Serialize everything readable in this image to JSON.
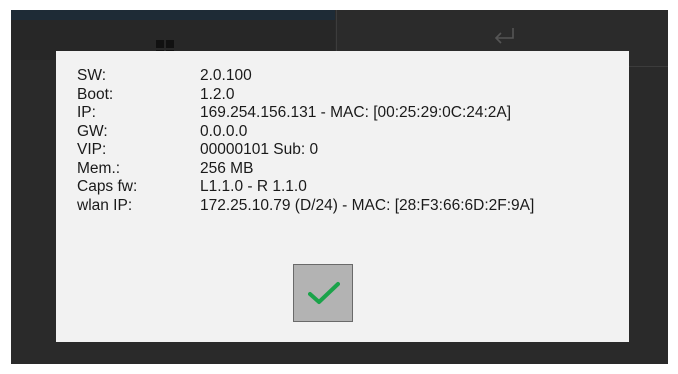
{
  "toolbar": {
    "left_icon": "grid-icon",
    "right_icon": "return-icon"
  },
  "dialog": {
    "rows": [
      {
        "label": "SW:",
        "value": "2.0.100"
      },
      {
        "label": "Boot:",
        "value": "1.2.0"
      },
      {
        "label": "IP:",
        "value": "169.254.156.131 - MAC: [00:25:29:0C:24:2A]"
      },
      {
        "label": "GW:",
        "value": "0.0.0.0"
      },
      {
        "label": "VIP:",
        "value": "00000101 Sub: 0"
      },
      {
        "label": "Mem.:",
        "value": "256 MB"
      },
      {
        "label": "Caps fw:",
        "value": "L1.1.0 - R 1.1.0"
      },
      {
        "label": "wlan IP:",
        "value": "172.25.10.79 (D/24) - MAC: [28:F3:66:6D:2F:9A]"
      }
    ],
    "confirm_icon": "checkmark-icon"
  },
  "colors": {
    "screen_bg": "#2a2a2a",
    "dialog_bg": "#f2f2f2",
    "button_bg": "#b3b3b3",
    "check": "#1aa34a",
    "accent_bar": "#1e2b36"
  }
}
